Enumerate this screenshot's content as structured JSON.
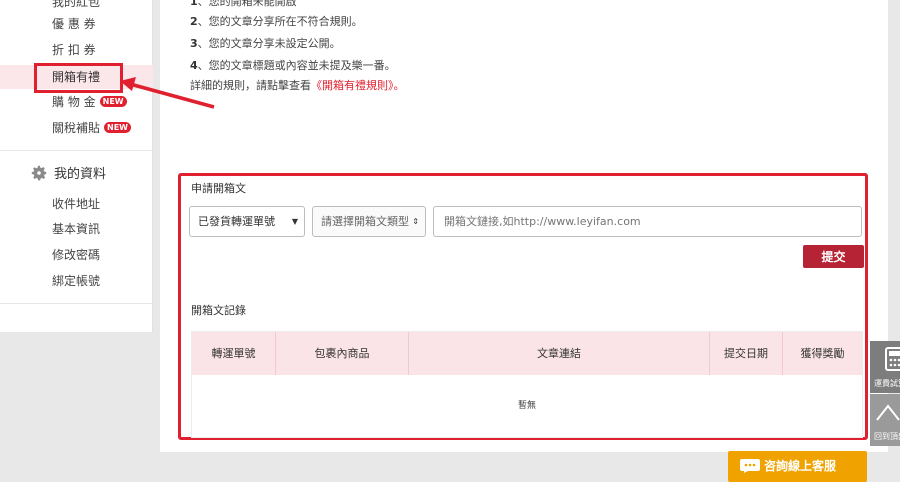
{
  "sidebar": {
    "items": [
      {
        "label": "我的紅包"
      },
      {
        "label": "優 惠 券"
      },
      {
        "label": "折 扣 券"
      },
      {
        "label": "開箱有禮"
      },
      {
        "label": "購 物 金",
        "badge": "NEW"
      },
      {
        "label": "關稅補貼",
        "badge": "NEW"
      }
    ],
    "profile_title": "我的資料",
    "profile_items": [
      {
        "label": "收件地址"
      },
      {
        "label": "基本資訊"
      },
      {
        "label": "修改密碼"
      },
      {
        "label": "綁定帳號"
      }
    ]
  },
  "rules": {
    "line1_num": "1",
    "line1": "、您的開箱未能開啟",
    "line2_num": "2",
    "line2": "、您的文章分享所在不符合規則。",
    "line3_num": "3",
    "line3": "、您的文章分享未設定公開。",
    "line4_num": "4",
    "line4": "、您的文章標題或內容並未提及樂一番。",
    "detail_prefix": "詳細的規則，請點擊查看",
    "detail_link": "《開箱有禮規則》",
    "detail_suffix": "。"
  },
  "apply": {
    "title": "申請開箱文",
    "waybill_select": "已發貨轉運單號",
    "type_select": "請選擇開箱文類型",
    "link_placeholder": "開箱文鏈接,如http://www.leyifan.com",
    "submit": "提交"
  },
  "record": {
    "title": "開箱文記錄",
    "columns": [
      "轉運單號",
      "包裹內商品",
      "文章連結",
      "提交日期",
      "獲得獎勵"
    ],
    "empty": "暫無"
  },
  "tools": {
    "calc_label": "運費試算",
    "top_label": "回到頂部"
  },
  "customer_service": "咨詢線上客服",
  "colors": {
    "accent_red": "#e0202f",
    "submit_bg": "#b52334",
    "table_head_bg": "#fbe4e8",
    "cs_bg": "#f0a300"
  }
}
